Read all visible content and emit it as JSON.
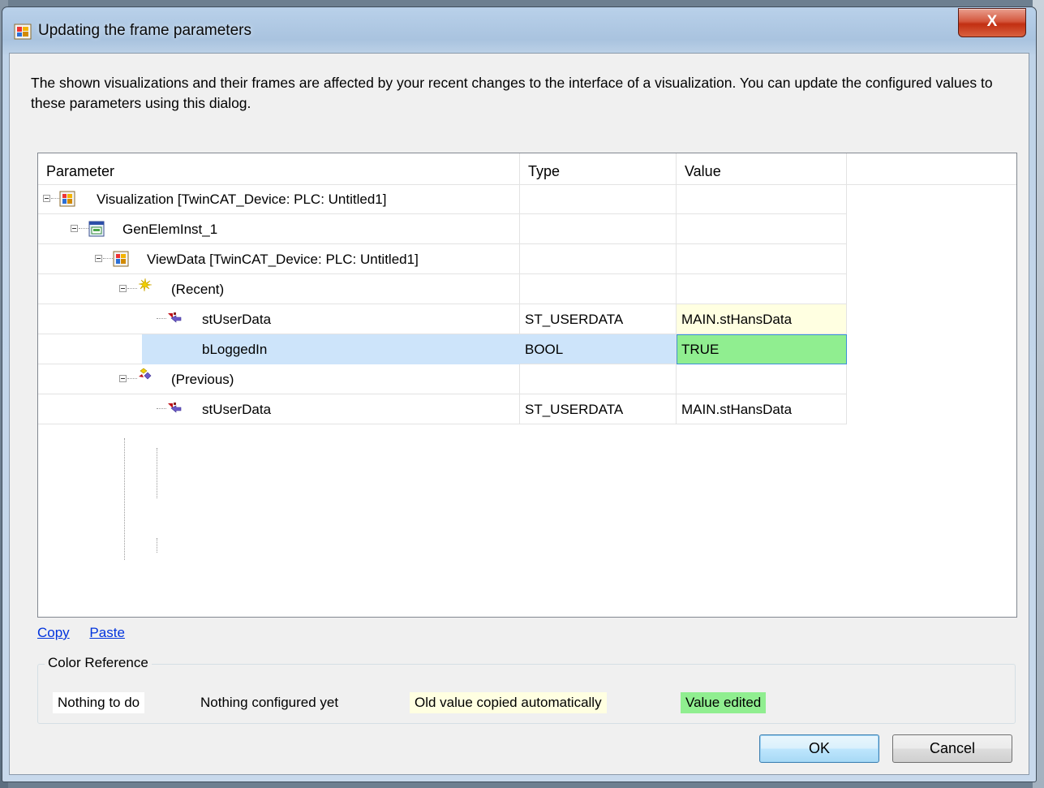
{
  "window": {
    "title": "Updating the frame parameters",
    "close_label": "X"
  },
  "description": "The shown visualizations and their frames are affected by your recent changes to the interface of a visualization. You can update the configured values to these parameters using this dialog.",
  "grid": {
    "columns": [
      "Parameter",
      "Type",
      "Value"
    ],
    "rows": [
      {
        "label": "Visualization [TwinCAT_Device: PLC: Untitled1]",
        "type": "",
        "value": "",
        "icon": "visualization-icon"
      },
      {
        "label": "GenElemInst_1",
        "type": "",
        "value": "",
        "icon": "frame-element-icon"
      },
      {
        "label": "ViewData [TwinCAT_Device: PLC: Untitled1]",
        "type": "",
        "value": "",
        "icon": "visualization-icon"
      },
      {
        "label": "(Recent)",
        "type": "",
        "value": "",
        "icon": "recent-icon"
      },
      {
        "label": "stUserData",
        "type": "ST_USERDATA",
        "value": "MAIN.stHansData",
        "icon": "parameter-icon"
      },
      {
        "label": "bLoggedIn",
        "type": "BOOL",
        "value": "TRUE",
        "icon": "parameter-icon"
      },
      {
        "label": "(Previous)",
        "type": "",
        "value": "",
        "icon": "previous-icon"
      },
      {
        "label": "stUserData",
        "type": "ST_USERDATA",
        "value": "MAIN.stHansData",
        "icon": "parameter-icon"
      }
    ]
  },
  "links": {
    "copy": "Copy",
    "paste": "Paste"
  },
  "color_reference": {
    "title": "Color Reference",
    "items": [
      {
        "label": "Nothing to do",
        "color": "#ffffff"
      },
      {
        "label": "Nothing configured yet",
        "color": "#f0f0f0"
      },
      {
        "label": "Old value copied automatically",
        "color": "#ffffe1"
      },
      {
        "label": "Value edited",
        "color": "#90ee90"
      }
    ]
  },
  "buttons": {
    "ok": "OK",
    "cancel": "Cancel"
  }
}
